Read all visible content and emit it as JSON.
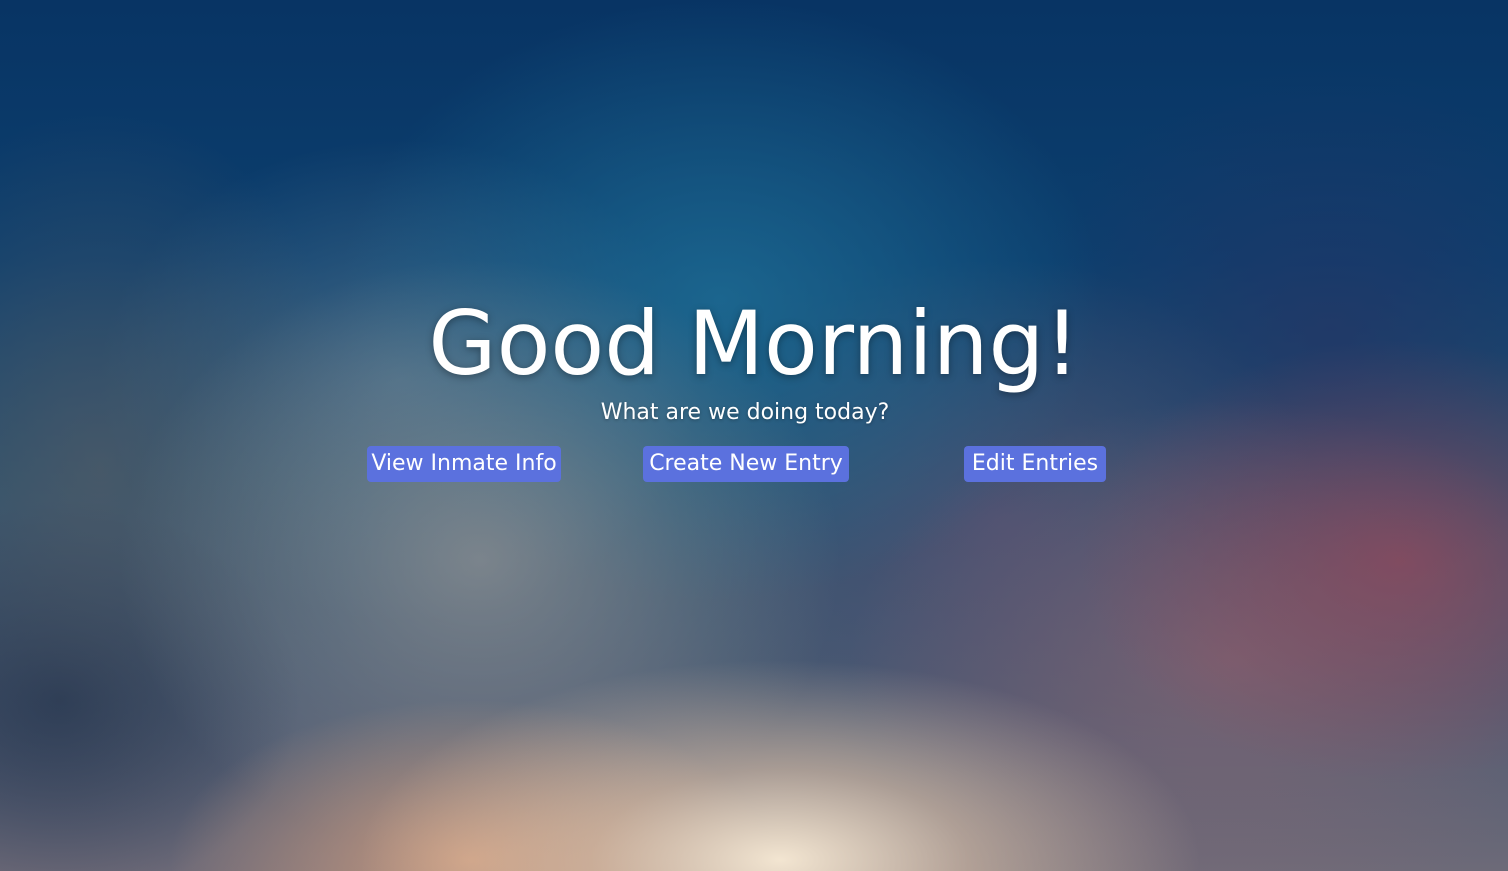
{
  "greeting": {
    "title": "Good Morning!",
    "subtitle": "What are we doing today?"
  },
  "actions": {
    "view_inmate_info": "View Inmate Info",
    "create_new_entry": "Create New Entry",
    "edit_entries": "Edit Entries"
  },
  "colors": {
    "button_background": "#5b71de",
    "text": "#ffffff"
  }
}
